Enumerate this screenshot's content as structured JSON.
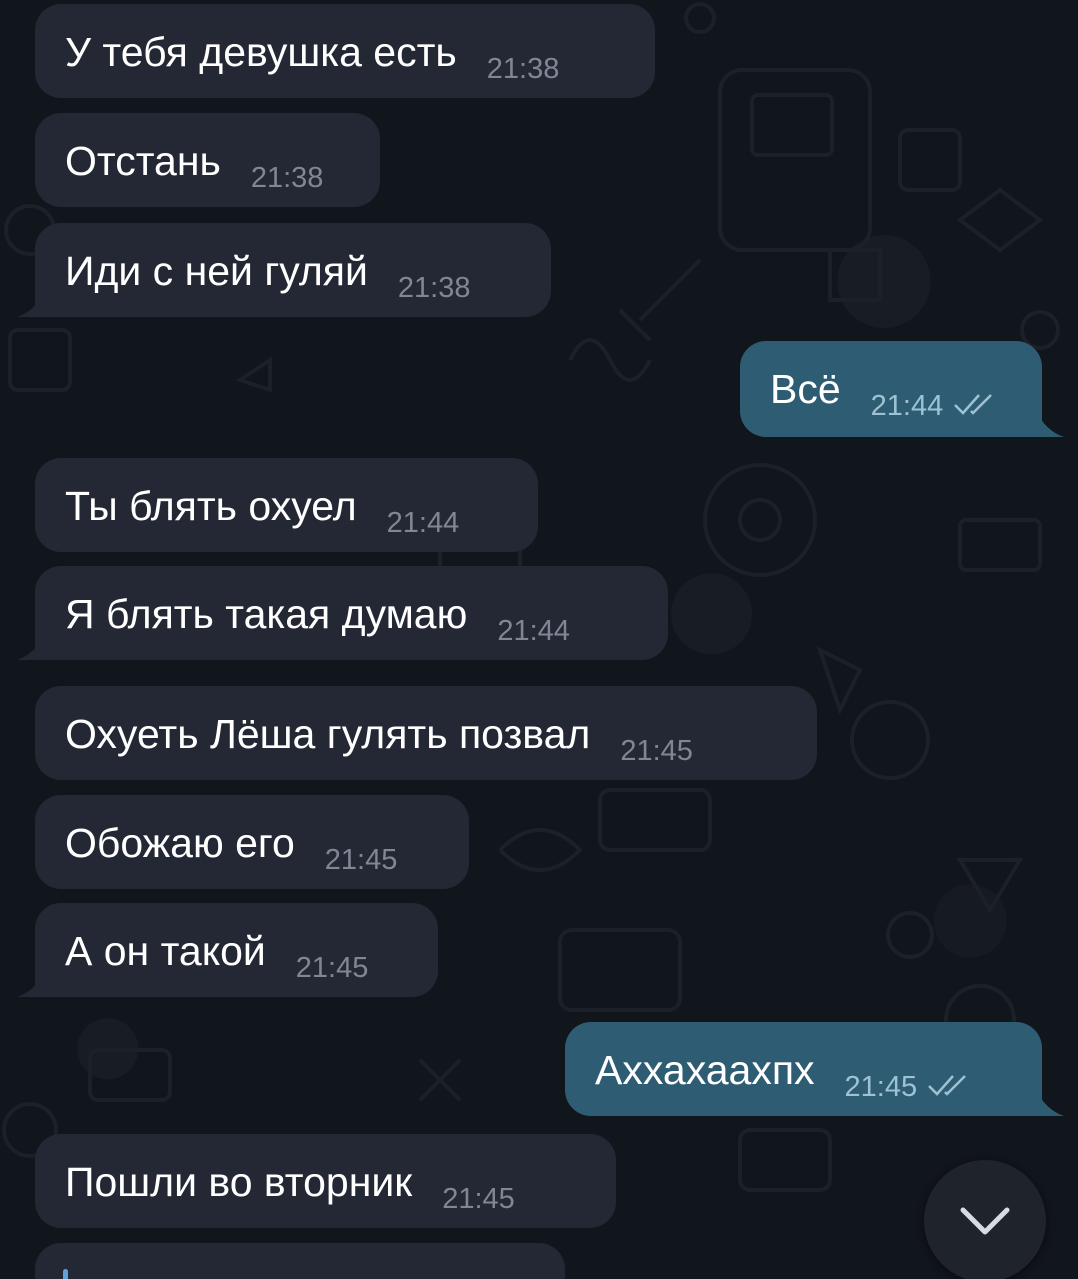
{
  "messages": [
    {
      "text": "У тебя девушка есть",
      "time": "21:38"
    },
    {
      "text": "Отстань",
      "time": "21:38"
    },
    {
      "text": "Иди с ней гуляй",
      "time": "21:38"
    },
    {
      "text": "Всё",
      "time": "21:44"
    },
    {
      "text": "Ты блять охуел",
      "time": "21:44"
    },
    {
      "text": "Я блять такая думаю",
      "time": "21:44"
    },
    {
      "text": "Охуеть Лёша гулять позвал",
      "time": "21:45"
    },
    {
      "text": "Обожаю его",
      "time": "21:45"
    },
    {
      "text": "А он такой",
      "time": "21:45"
    },
    {
      "text": "Аххахаахпх",
      "time": "21:45"
    },
    {
      "text": "Пошли во вторник",
      "time": "21:45"
    }
  ],
  "colors": {
    "incoming_bubble": "#232834",
    "outgoing_bubble": "#2e5c73",
    "background": "#11151c"
  },
  "icons": {
    "read_receipt": "double-check-icon",
    "scroll_down": "chevron-down-icon"
  }
}
